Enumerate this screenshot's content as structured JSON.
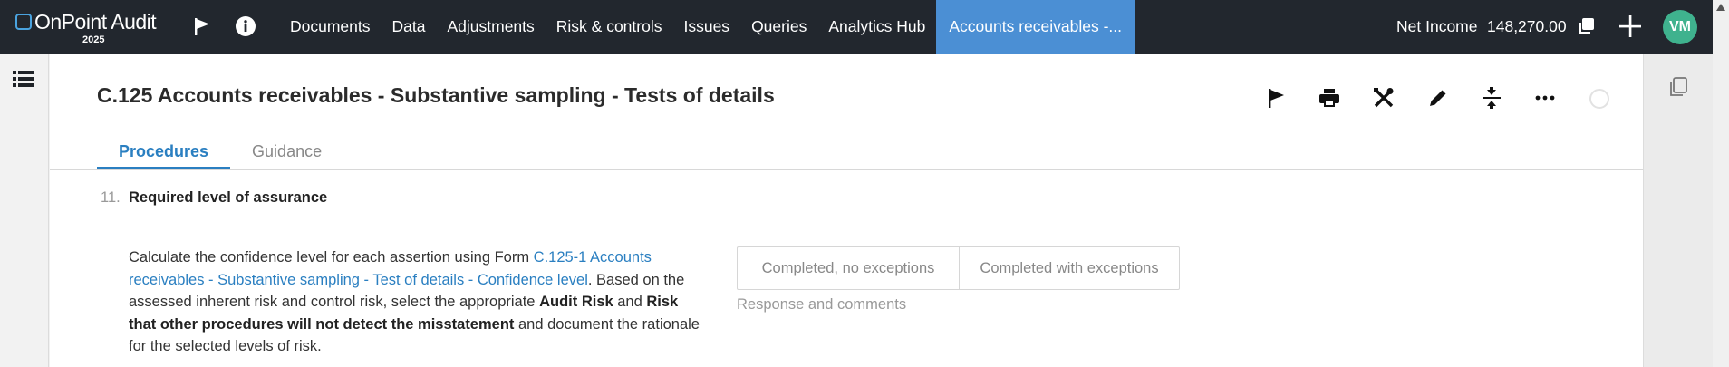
{
  "app": {
    "name": "OnPoint Audit",
    "year": "2025"
  },
  "nav": {
    "items": [
      {
        "label": "Documents"
      },
      {
        "label": "Data"
      },
      {
        "label": "Adjustments"
      },
      {
        "label": "Risk & controls"
      },
      {
        "label": "Issues"
      },
      {
        "label": "Queries"
      },
      {
        "label": "Analytics Hub"
      },
      {
        "label": "Accounts receivables -..."
      }
    ],
    "active_index": 7
  },
  "summary": {
    "label": "Net Income",
    "value": "148,270.00"
  },
  "user": {
    "initials": "VM"
  },
  "page": {
    "title": "C.125 Accounts receivables - Substantive sampling - Tests of details"
  },
  "tabs": [
    {
      "label": "Procedures"
    },
    {
      "label": "Guidance"
    }
  ],
  "active_tab": 0,
  "step": {
    "number": "11.",
    "title": "Required level of assurance",
    "text": {
      "part1": "Calculate the confidence level for each assertion using Form ",
      "link": "C.125-1 Accounts receivables - Substantive sampling - Test of details - Confidence level",
      "part2": ". Based on the assessed inherent risk and control risk, select the appropriate ",
      "bold1": "Audit Risk",
      "part3": " and ",
      "bold2": "Risk that other procedures will not detect the misstatement",
      "part4": " and document the rationale for the selected levels of risk."
    }
  },
  "response": {
    "option1": "Completed, no exceptions",
    "option2": "Completed with exceptions",
    "comments_label": "Response and comments"
  },
  "icons": {
    "flag": "flag-icon",
    "info": "info-icon",
    "copy": "copy-icon",
    "add": "plus-icon",
    "list": "list-icon",
    "print": "print-icon",
    "tools": "tools-icon",
    "edit": "pencil-icon",
    "collapse": "collapse-icon",
    "more": "more-icon",
    "panel_copy": "copy-outline-icon"
  },
  "colors": {
    "topbar": "#22272e",
    "active_nav": "#4b8fd4",
    "accent": "#2a7fc1",
    "avatar": "#3fb28e"
  }
}
